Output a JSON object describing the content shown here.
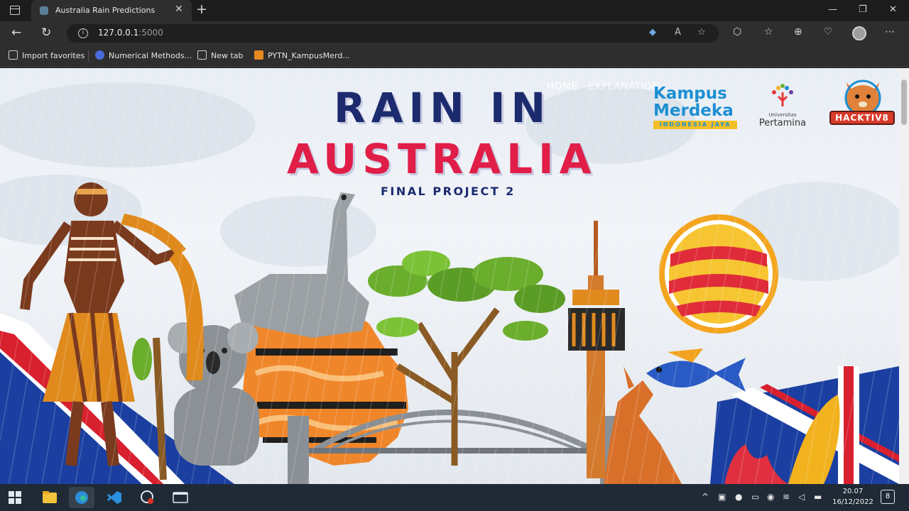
{
  "browser": {
    "tab_title": "Australia Rain Predictions",
    "new_tab_symbol": "+",
    "close_symbol": "✕",
    "url_host": "127.0.0.1",
    "url_port": ":5000",
    "favorites": [
      "Import favorites",
      "Numerical Methods...",
      "New tab",
      "PYTN_KampusMerd..."
    ]
  },
  "page": {
    "nav": [
      "HOME",
      "EXPLANATION"
    ],
    "title_line1": "RAIN IN",
    "title_line2": "AUSTRALIA",
    "subtitle": "FINAL PROJECT 2",
    "logos": {
      "kampus_line1": "Kampus",
      "kampus_line2": "Merdeka",
      "kampus_line3": "INDONESIA JAYA",
      "pertamina_small": "Universitas",
      "pertamina_big": "Pertamina",
      "hacktiv8": "HACKTIV8"
    }
  },
  "taskbar": {
    "time": "20.07",
    "date": "16/12/2022",
    "notification_count": "8"
  },
  "colors": {
    "title_navy": "#1c2a6e",
    "title_red": "#e01e48",
    "taskbar": "#1f2a36"
  }
}
